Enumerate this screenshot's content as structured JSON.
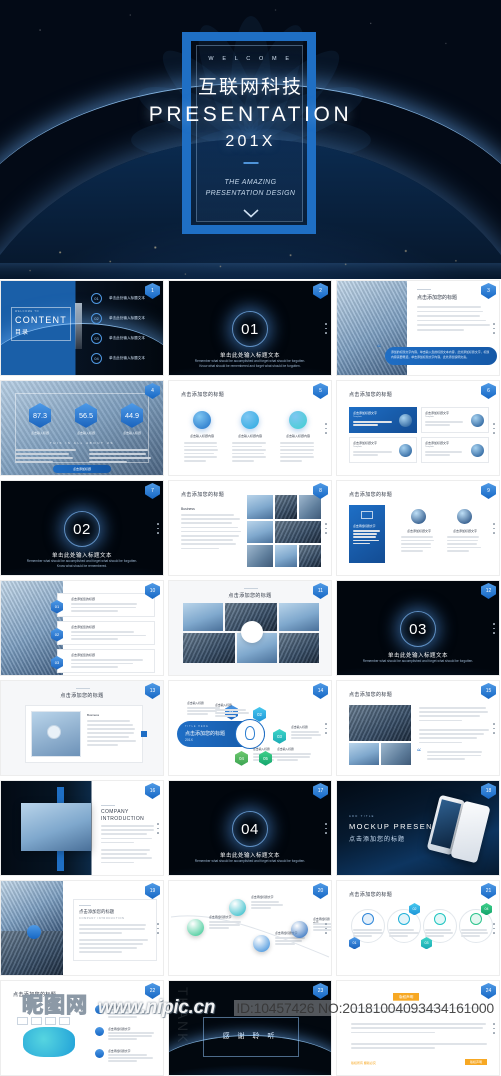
{
  "hero": {
    "welcome": "W E L C O M E",
    "cn_title": "互联网科技",
    "en_title": "PRESENTATION",
    "year": "201X",
    "subtitle_line1": "THE AMAZING",
    "subtitle_line2": "PRESENTATION DESIGN",
    "scroll_icon": "chevron-down-icon",
    "accent_color": "#1f6fc4"
  },
  "watermark": {
    "logo_text": "昵图网",
    "url": "www.nipic.cn",
    "id_text": "ID:10457426 NO:20181004093434161000"
  },
  "grid": {
    "columns": 3,
    "thumbnails": [
      {
        "badge": "1",
        "kind": "content-directory",
        "title_eyebrow": "WELCOME TO",
        "title": "CONTENT",
        "title_cn": "目录",
        "items": [
          {
            "num": "01",
            "label": "单击此处输入标题文本"
          },
          {
            "num": "02",
            "label": "单击此处输入标题文本"
          },
          {
            "num": "03",
            "label": "单击此处输入标题文本"
          },
          {
            "num": "04",
            "label": "单击此处输入标题文本"
          }
        ]
      },
      {
        "badge": "2",
        "kind": "section-divider",
        "number": "01",
        "title_cn": "单击此处输入标题文本",
        "desc": "Remember what should be accomplished and forget what should be forgotten. Know what should be remembered and forget what should be forgotten."
      },
      {
        "badge": "3",
        "kind": "photo-text-quote",
        "title": "点击添加您的标题",
        "quote": "添加的标题文字内容，单击输入您的标题文本内容，此处添加标题文字，标题内容需要概括，单击添加标题文字内容，此处添加说明文案。"
      },
      {
        "badge": "4",
        "kind": "stats-three",
        "stats": [
          {
            "value": "87.3",
            "label": "点击输入标题"
          },
          {
            "value": "56.5",
            "label": "点击输入标题"
          },
          {
            "value": "44.9",
            "label": "点击输入标题"
          }
        ],
        "caption": "THIS IS ALL ABOUT US",
        "button": "点击添加标题"
      },
      {
        "badge": "5",
        "kind": "icons-three",
        "title": "点击添加您的标题",
        "cards": [
          {
            "icon": "gear-icon",
            "label": "点击输入标题内容"
          },
          {
            "icon": "check-icon",
            "label": "点击输入标题内容"
          },
          {
            "icon": "shield-icon",
            "label": "点击输入标题内容"
          }
        ]
      },
      {
        "badge": "6",
        "kind": "card-grid-four",
        "title": "点击添加您的标题",
        "cards": [
          {
            "label": "点击添加标题文字",
            "sub": "Template",
            "active": true
          },
          {
            "label": "点击添加标题文字",
            "sub": "Template",
            "active": false
          },
          {
            "label": "点击添加标题文字",
            "sub": "Template",
            "active": false
          },
          {
            "label": "点击添加标题文字",
            "sub": "Template",
            "active": false
          }
        ]
      },
      {
        "badge": "7",
        "kind": "section-divider",
        "number": "02",
        "title_cn": "单击此处输入标题文本",
        "desc": "Remember what should be accomplished and forget what should be forgotten. Know what should be remembered."
      },
      {
        "badge": "8",
        "kind": "text-collage",
        "title": "点击添加您的标题",
        "subtitle": "Business"
      },
      {
        "badge": "9",
        "kind": "book-cards",
        "title": "点击添加您的标题",
        "cards": [
          {
            "label": "点击添加标题文字"
          },
          {
            "label": "点击添加标题文字"
          },
          {
            "label": "点击添加标题文字"
          }
        ]
      },
      {
        "badge": "10",
        "kind": "photo-list",
        "title": "点击添加您的标题"
      },
      {
        "badge": "11",
        "kind": "photo-mosaic",
        "title": "点击添加您的标题"
      },
      {
        "badge": "12",
        "kind": "section-divider",
        "number": "03",
        "title_cn": "单击此处输入标题文本",
        "desc": "Remember what should be accomplished and forget what should be forgotten."
      },
      {
        "badge": "13",
        "kind": "mockup-monitor",
        "title": "点击添加您的标题",
        "subtitle": "Business"
      },
      {
        "badge": "14",
        "kind": "hex-infographic",
        "title": "点击添加您的标题",
        "title_year": "201X",
        "icon": "lightbulb-icon",
        "nodes": [
          {
            "num": "01",
            "label": "点击输入标题",
            "color": "blue"
          },
          {
            "num": "02",
            "label": "点击输入标题",
            "color": "cyan"
          },
          {
            "num": "03",
            "label": "点击输入标题",
            "color": "teal"
          },
          {
            "num": "04",
            "label": "点击输入标题",
            "color": "green"
          },
          {
            "num": "05",
            "label": "点击输入标题",
            "color": "emerald"
          }
        ]
      },
      {
        "badge": "15",
        "kind": "photo-bullets",
        "title": "点击添加您的标题"
      },
      {
        "badge": "16",
        "kind": "company-intro",
        "title": "COMPANY INTRODUCTION"
      },
      {
        "badge": "17",
        "kind": "section-divider",
        "number": "04",
        "title_cn": "单击此处输入标题文本",
        "desc": "Remember what should be accomplished and forget what should be forgotten."
      },
      {
        "badge": "18",
        "kind": "mockup-phones",
        "title": "MOCKUP PRESENTATION",
        "title_cn": "点击添加您的标题",
        "eyebrow": "ADD TITLE"
      },
      {
        "badge": "19",
        "kind": "photo-text-box",
        "title": "点击添加您的标题",
        "subtitle": "COMPANY  INTRODUCTION"
      },
      {
        "badge": "20",
        "kind": "curve-timeline",
        "nodes": [
          {
            "icon": "monitor-icon",
            "label": "点击添加标题文字",
            "color": "emerald"
          },
          {
            "icon": "camera-icon",
            "label": "点击添加标题文字",
            "color": "teal"
          },
          {
            "icon": "rocket-icon",
            "label": "点击添加标题文字",
            "color": "blue"
          },
          {
            "icon": "printer-icon",
            "label": "点击添加标题文字",
            "color": "blue"
          }
        ]
      },
      {
        "badge": "21",
        "kind": "circle-process",
        "title": "点击添加您的标题",
        "nodes": [
          {
            "num": "01",
            "icon": "pen-icon",
            "color": "blue"
          },
          {
            "num": "02",
            "icon": "doc-icon",
            "color": "cyan"
          },
          {
            "num": "03",
            "icon": "edit-icon",
            "color": "teal"
          },
          {
            "num": "04",
            "icon": "plane-icon",
            "color": "emerald"
          }
        ]
      },
      {
        "badge": "22",
        "kind": "checklist",
        "title": "点击添加您的标题",
        "items": [
          {
            "label": "点击添加标题文字"
          },
          {
            "label": "点击添加标题文字"
          },
          {
            "label": "点击添加标题文字"
          }
        ]
      },
      {
        "badge": "23",
        "kind": "thanks",
        "title_cn": "感 谢 聆 听",
        "watermark_letters": "THANK"
      },
      {
        "badge": "24",
        "kind": "copyright",
        "title": "版权声明"
      }
    ]
  }
}
